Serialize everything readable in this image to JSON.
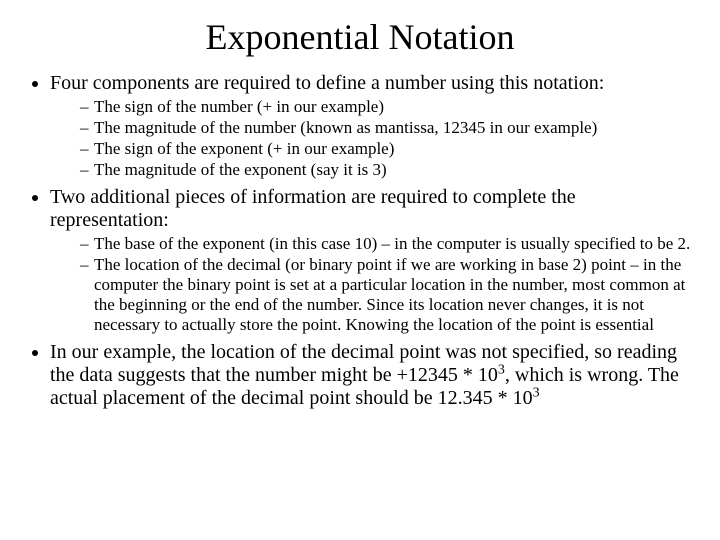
{
  "title": "Exponential Notation",
  "bullet1": "Four components are required to define a number using this notation:",
  "sub1": [
    "The sign of the number (+ in our example)",
    "The magnitude of the number (known as mantissa, 12345 in our example)",
    "The sign of the exponent (+ in our example)",
    "The magnitude of the exponent (say it is 3)"
  ],
  "bullet2": "Two additional pieces of information are required to complete the representation:",
  "sub2": [
    "The base of the exponent (in this case 10) – in the computer is usually specified to be 2.",
    "The location of the decimal (or binary point if we are working in base 2) point – in the computer the binary point is set at a particular location in the number, most common at the beginning or the end of the number. Since its location never changes, it is not necessary to actually store the point. Knowing the location of the point is essential"
  ],
  "bullet3": {
    "part1": "In our example, the location of the decimal point was not specified, so reading the data suggests that the number might be +12345 * 10",
    "sup1": "3",
    "part2": ", which is wrong. The actual placement of the decimal point should be 12.345 * 10",
    "sup2": "3"
  }
}
